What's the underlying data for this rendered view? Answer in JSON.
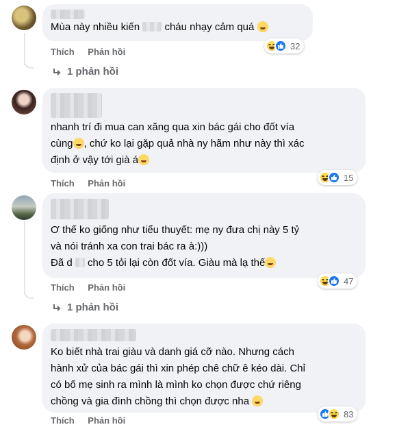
{
  "comments": [
    {
      "text_before": "Mùa này nhiều kiến",
      "text_after": "cháu nhạy cảm quá",
      "actions": {
        "like": "Thích",
        "reply": "Phản hồi"
      },
      "reaction_count": "32",
      "reaction_icons": [
        "haha-icon",
        "like-icon"
      ],
      "replies_label": "1 phản hồi"
    },
    {
      "line1": "nhanh trí đi mua can xăng qua xin bác gái cho đốt vía",
      "line2_before": "cùng",
      "line2_after": ", chứ ko lại gặp quả nhà ny hãm như này thì xác",
      "line3": "định ở vậy tới già á",
      "actions": {
        "like": "Thích",
        "reply": "Phản hồi"
      },
      "reaction_count": "15",
      "reaction_icons": [
        "haha-icon",
        "like-icon"
      ]
    },
    {
      "line1": "Ơ thế ko giống như tiểu thuyết: mẹ ny đưa chị này 5 tỷ",
      "line2": "và nói tránh xa con trai bác ra à:)))",
      "line3_before": "Đã d",
      "line3_after": "cho 5 tỏi lại còn đốt vía. Giàu mà lạ thế",
      "actions": {
        "like": "Thích",
        "reply": "Phản hồi"
      },
      "reaction_count": "47",
      "reaction_icons": [
        "haha-icon",
        "like-icon"
      ],
      "replies_label": "1 phản hồi"
    },
    {
      "line1": "Ko biết nhà trai giàu và danh giá cỡ nào. Nhưng cách",
      "line2": "hành xử của bác gái thì xin phép chê chữ ê kéo dài. Chỉ",
      "line3": "có bố mẹ sinh ra mình là mình ko chọn được chứ riêng",
      "line4": "chồng và gia đình chồng thì chọn được nha",
      "actions": {
        "like": "Thích",
        "reply": "Phản hồi"
      },
      "reaction_count": "83",
      "reaction_icons": [
        "like-icon",
        "haha-icon"
      ]
    }
  ],
  "colors": {
    "bubble": "#f0f2f5",
    "meta": "#65676b",
    "like_blue": "#1877f2",
    "thread": "#e4e6eb"
  }
}
